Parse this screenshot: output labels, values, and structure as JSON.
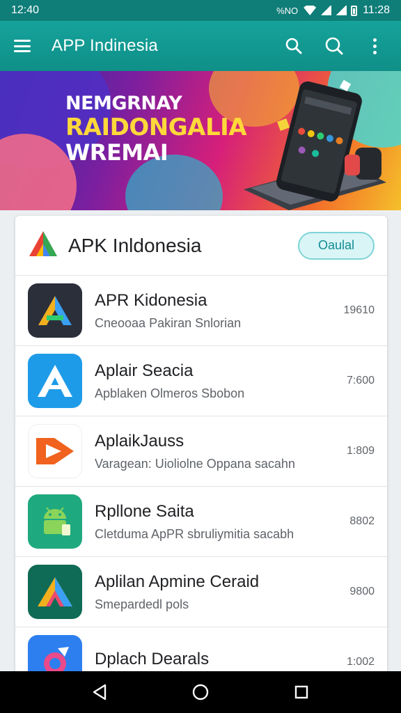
{
  "status_bar": {
    "time_left": "12:40",
    "indicators": "%NO",
    "time_right": "11:28"
  },
  "app_bar": {
    "title": "APP Indinesia",
    "icons": [
      "menu-icon",
      "search-icon",
      "search-icon",
      "more-vert-icon"
    ]
  },
  "banner": {
    "line1": "NEMGRNAY",
    "line2": "RAIDONGALIA",
    "line3": "WREMAI"
  },
  "card": {
    "header_title": "APK Inldonesia",
    "header_button": "Oaulal",
    "apps": [
      {
        "name": "APR Kidonesia",
        "desc": "Cneooaa Pakiran Snlorian",
        "size": "19610",
        "icon": "triangle-a-icon"
      },
      {
        "name": "Aplair Seacia",
        "desc": "Apblaken Olmeros Sbobon",
        "size": "7:600",
        "icon": "letter-a-icon"
      },
      {
        "name": "AplaikJauss",
        "desc": "Varagean: Uioliolne Oppana sacahn",
        "size": "1:809",
        "icon": "play-icon"
      },
      {
        "name": "Rpllone Saita",
        "desc": "Cletduma ApPR sbruliymitia sacabh",
        "size": "8802",
        "icon": "android-icon"
      },
      {
        "name": "Aplilan Apmine Ceraid",
        "desc": "Smepardedl pols",
        "size": "9800",
        "icon": "prism-icon"
      },
      {
        "name": "Dplach Dearals",
        "desc": "",
        "size": "1:002",
        "icon": "camera-icon"
      }
    ]
  },
  "colors": {
    "teal": "#0f8f88",
    "accent": "#128c92",
    "banner_yellow": "#ffd83a"
  }
}
